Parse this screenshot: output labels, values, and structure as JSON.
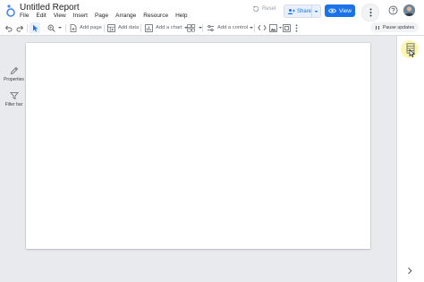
{
  "header": {
    "title": "Untitled Report",
    "menu": [
      "File",
      "Edit",
      "View",
      "Insert",
      "Page",
      "Arrange",
      "Resource",
      "Help"
    ],
    "reset_label": "Reset",
    "share_label": "Share",
    "view_label": "View"
  },
  "toolbar": {
    "add_page": "Add page",
    "add_data": "Add data",
    "add_chart": "Add a chart",
    "add_control": "Add a control",
    "pause_updates": "Pause updates"
  },
  "right_panel": {
    "items": [
      "Properties",
      "Filter bar"
    ]
  },
  "colors": {
    "accent": "#1a73e8",
    "canvas_bg": "#e8eaed",
    "data_highlight": "#fcf6b0"
  },
  "icons": [
    "looker-studio-logo-icon",
    "undo-icon",
    "redo-icon",
    "cursor-icon",
    "zoom-icon",
    "add-page-icon",
    "add-data-icon",
    "add-chart-icon",
    "community-viz-icon",
    "add-control-icon",
    "code-icon",
    "image-icon",
    "frame-icon",
    "more-vert-icon",
    "data-icon",
    "properties-icon",
    "filter-icon",
    "help-icon",
    "chevron-right-icon"
  ]
}
